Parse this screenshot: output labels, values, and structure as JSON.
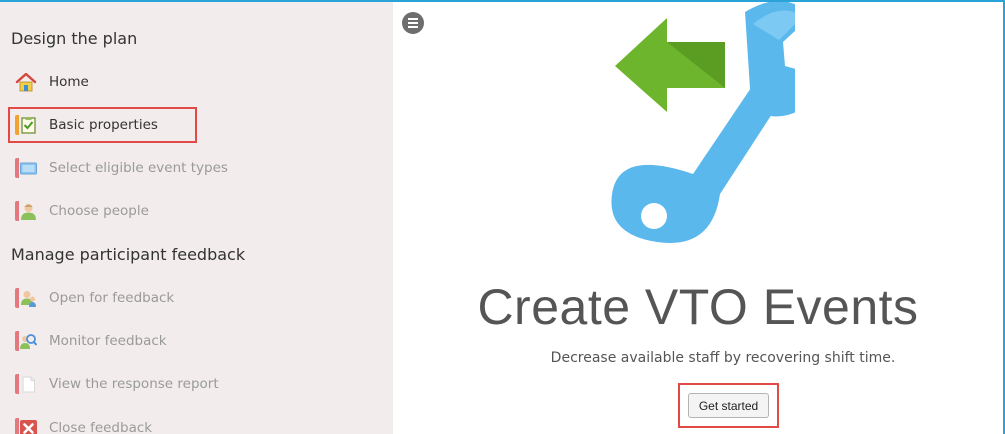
{
  "sidebar": {
    "sections": [
      {
        "title": "Design the plan"
      },
      {
        "title": "Manage participant feedback"
      }
    ],
    "items": [
      {
        "label": "Home",
        "icon": "home-icon",
        "state": "enabled"
      },
      {
        "label": "Basic properties",
        "icon": "checklist-icon",
        "state": "active",
        "highlighted": true
      },
      {
        "label": "Select eligible event types",
        "icon": "monitor-icon",
        "state": "disabled"
      },
      {
        "label": "Choose people",
        "icon": "person-icon",
        "state": "disabled"
      },
      {
        "label": "Open for feedback",
        "icon": "people-icon",
        "state": "disabled"
      },
      {
        "label": "Monitor feedback",
        "icon": "magnifier-person-icon",
        "state": "disabled"
      },
      {
        "label": "View the response report",
        "icon": "document-icon",
        "state": "disabled"
      },
      {
        "label": "Close feedback",
        "icon": "close-box-icon",
        "state": "disabled"
      }
    ]
  },
  "main": {
    "menu_icon": "hamburger-icon",
    "hero_icon": "wrench-with-arrow-icon",
    "title": "Create VTO Events",
    "subtitle": "Decrease available staff by recovering shift time.",
    "button_label": "Get started"
  },
  "colors": {
    "accent_border": "#2aa3d8",
    "highlight_red": "#e14a47",
    "sidebar_bg": "#f2ecec",
    "tab_red": "#e3787f",
    "tab_orange": "#f0a330",
    "wrench_blue": "#5bb8ec",
    "arrow_green": "#6cb52d"
  }
}
